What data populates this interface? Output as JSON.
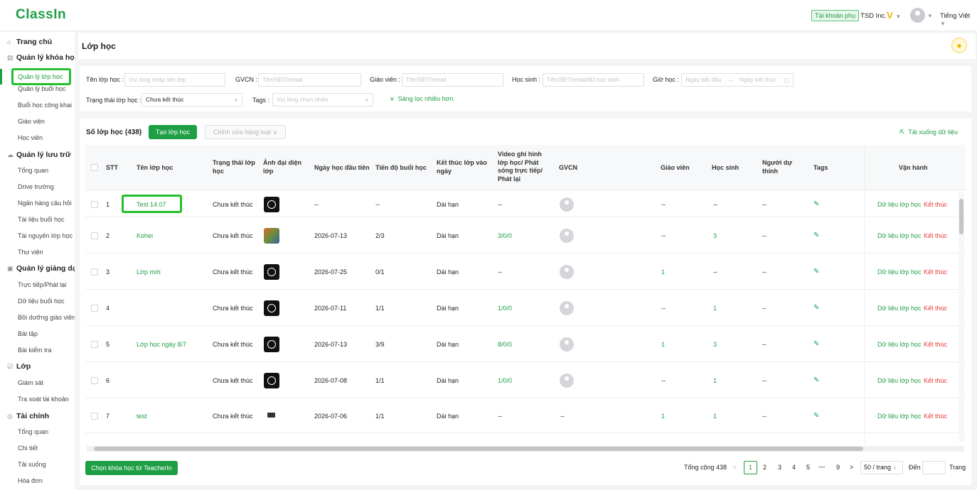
{
  "app": {
    "logo": "ClassIn"
  },
  "header": {
    "sub_account": "Tài khoản phụ",
    "org": "TSD Inc.",
    "v_badge": "V",
    "language": "Tiếng Việt"
  },
  "sidebar": {
    "items": [
      {
        "label": "Trang chủ",
        "type": "section",
        "icon": "home-icon"
      },
      {
        "label": "Quản lý khóa học",
        "type": "section",
        "icon": "course-icon"
      },
      {
        "label": "Quản lý lớp học",
        "type": "active"
      },
      {
        "label": "Quản lý buổi học",
        "type": "sub"
      },
      {
        "label": "Buổi học công khai",
        "type": "sub"
      },
      {
        "label": "Giáo viên",
        "type": "sub"
      },
      {
        "label": "Học viên",
        "type": "sub"
      },
      {
        "label": "Quản lý lưu trữ",
        "type": "section",
        "icon": "cloud-icon"
      },
      {
        "label": "Tổng quan",
        "type": "sub"
      },
      {
        "label": "Drive trường",
        "type": "sub"
      },
      {
        "label": "Ngân hàng câu hỏi",
        "type": "sub"
      },
      {
        "label": "Tài liệu buổi học",
        "type": "sub"
      },
      {
        "label": "Tài nguyên lớp học",
        "type": "sub"
      },
      {
        "label": "Thư viện",
        "type": "sub"
      },
      {
        "label": "Quản lý giảng dạy",
        "type": "section",
        "icon": "teaching-icon"
      },
      {
        "label": "Trực tiếp/Phát lại",
        "type": "sub"
      },
      {
        "label": "Dữ liệu buổi học",
        "type": "sub"
      },
      {
        "label": "Bồi dưỡng giáo viên",
        "type": "sub"
      },
      {
        "label": "Bài tập",
        "type": "sub"
      },
      {
        "label": "Bài kiểm tra",
        "type": "sub"
      },
      {
        "label": "Lớp",
        "type": "section",
        "icon": "class-icon"
      },
      {
        "label": "Giám sát",
        "type": "sub"
      },
      {
        "label": "Tra soát tài khoản",
        "type": "sub"
      },
      {
        "label": "Tài chính",
        "type": "section",
        "icon": "finance-icon"
      },
      {
        "label": "Tổng quan",
        "type": "sub"
      },
      {
        "label": "Chi tiết",
        "type": "sub"
      },
      {
        "label": "Tải xuống",
        "type": "sub"
      },
      {
        "label": "Hóa đơn",
        "type": "sub"
      }
    ]
  },
  "page": {
    "title": "Lớp học"
  },
  "filters": {
    "class_name_label": "Tên lớp học :",
    "class_name_placeholder": "Vui lòng nhập tên lớp",
    "gvcn_label": "GVCN :",
    "gvcn_placeholder": "Tên/SĐT/email",
    "teacher_label": "Giáo viên :",
    "teacher_placeholder": "Tên/SĐT/email",
    "student_label": "Học sinh :",
    "student_placeholder": "Tên/SĐT/email/ID học sinh",
    "time_label": "Giờ học :",
    "start_placeholder": "Ngày bắt đầu",
    "arrow": "→",
    "end_placeholder": "Ngày kết thúc",
    "status_label": "Trạng thái lớp học :",
    "status_value": "Chưa kết thúc",
    "tags_label": "Tags :",
    "tags_placeholder": "Vui lòng chọn nhãn",
    "more_filters": "Sàng lọc nhiều hơn"
  },
  "toolbar": {
    "count_label": "Số lớp học (438)",
    "create_button": "Tạo lớp học",
    "batch_edit": "Chỉnh sửa hàng loạt",
    "download": "Tải xuống dữ liệu"
  },
  "table": {
    "headers": {
      "stt": "STT",
      "name": "Tên lớp học",
      "status": "Trạng thái lớp học",
      "avatar": "Ảnh đại diện lớp",
      "first_day": "Ngày học đầu tiên",
      "progress": "Tiến độ buổi học",
      "end_day": "Kết thúc lớp vào ngày",
      "video": "Video ghi hình lớp học/ Phát sóng trực tiếp/ Phát lại",
      "gvcn": "GVCN",
      "teacher": "Giáo viên",
      "student": "Học sinh",
      "auditor": "Người dự thính",
      "tags": "Tags",
      "ops": "Vận hành"
    },
    "rows": [
      {
        "stt": "1",
        "name": "Test 14.07",
        "status": "Chưa kết thúc",
        "thumb": "dark",
        "first_day": "--",
        "progress": "--",
        "end_day": "Dài hạn",
        "video": "--",
        "gvcn": "avatar",
        "teacher": "--",
        "student": "--",
        "auditor": "--",
        "op1": "Dữ liệu lớp học",
        "op2": "Kết thúc"
      },
      {
        "stt": "2",
        "name": "Kohei",
        "status": "Chưa kết thúc",
        "thumb": "kohei",
        "first_day": "2026-07-13",
        "progress": "2/3",
        "end_day": "Dài hạn",
        "video": "3/0/0",
        "gvcn": "avatar",
        "teacher": "--",
        "student": "3",
        "auditor": "--",
        "op1": "Dữ liệu lớp học",
        "op2": "Kết thúc"
      },
      {
        "stt": "3",
        "name": "Lớp mới",
        "status": "Chưa kết thúc",
        "thumb": "dark",
        "first_day": "2026-07-25",
        "progress": "0/1",
        "end_day": "Dài hạn",
        "video": "--",
        "gvcn": "avatar",
        "teacher": "1",
        "student": "--",
        "auditor": "--",
        "op1": "Dữ liệu lớp học",
        "op2": "Kết thúc"
      },
      {
        "stt": "4",
        "name": "",
        "status": "Chưa kết thúc",
        "thumb": "dark",
        "first_day": "2026-07-11",
        "progress": "1/1",
        "end_day": "Dài hạn",
        "video": "1/0/0",
        "gvcn": "avatar",
        "teacher": "--",
        "student": "1",
        "auditor": "--",
        "op1": "Dữ liệu lớp học",
        "op2": "Kết thúc"
      },
      {
        "stt": "5",
        "name": "Lớp học ngày 8/7",
        "status": "Chưa kết thúc",
        "thumb": "dark",
        "first_day": "2026-07-13",
        "progress": "3/9",
        "end_day": "Dài hạn",
        "video": "8/0/0",
        "gvcn": "avatar",
        "teacher": "1",
        "student": "3",
        "auditor": "--",
        "op1": "Dữ liệu lớp học",
        "op2": "Kết thúc"
      },
      {
        "stt": "6",
        "name": "",
        "status": "Chưa kết thúc",
        "thumb": "dark",
        "first_day": "2026-07-08",
        "progress": "1/1",
        "end_day": "Dài hạn",
        "video": "1/0/0",
        "gvcn": "avatar",
        "teacher": "--",
        "student": "1",
        "auditor": "--",
        "op1": "Dữ liệu lớp học",
        "op2": "Kết thúc"
      },
      {
        "stt": "7",
        "name": "test",
        "status": "Chưa kết thúc",
        "thumb": "test",
        "first_day": "2026-07-06",
        "progress": "1/1",
        "end_day": "Dài hạn",
        "video": "--",
        "gvcn": "--",
        "teacher": "1",
        "student": "1",
        "auditor": "--",
        "op1": "Dữ liệu lớp học",
        "op2": "Kết thúc"
      }
    ]
  },
  "footer": {
    "teacherin_button": "Chọn khóa học từ TeacherIn",
    "total": "Tổng cộng 438",
    "prev": "<",
    "pages": [
      "1",
      "2",
      "3",
      "4",
      "5",
      "•••",
      "9"
    ],
    "next": ">",
    "page_size": "50 / trang",
    "goto_label": "Đến",
    "page_suffix": "Trang"
  },
  "colors": {
    "accent": "#1e9e45",
    "danger": "#e53935",
    "highlight": "#22c02c"
  }
}
